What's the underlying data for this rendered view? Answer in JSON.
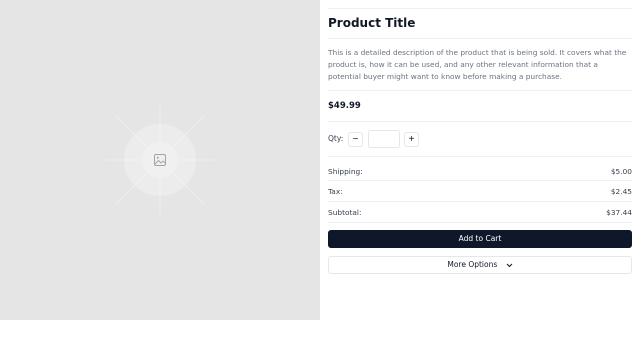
{
  "product": {
    "title": "Product Title",
    "description": "This is a detailed description of the product that is being sold. It covers what the product is, how it can be used, and any other relevant information that a potential buyer might want to know before making a purchase.",
    "price": "$49.99",
    "image_icon": "image-placeholder-icon"
  },
  "quantity": {
    "label": "Qty:",
    "value": "",
    "decrement_label": "−",
    "increment_label": "+"
  },
  "summary": {
    "shipping_label": "Shipping:",
    "shipping_value": "$5.00",
    "tax_label": "Tax:",
    "tax_value": "$2.45",
    "subtotal_label": "Subtotal:",
    "subtotal_value": "$37.44"
  },
  "actions": {
    "add_to_cart_label": "Add to Cart",
    "more_options_label": "More Options",
    "more_options_icon": "chevron-down-icon"
  },
  "colors": {
    "primary_button": "#0f172a",
    "image_background": "#e5e5e5",
    "muted_text": "#6b7280"
  }
}
